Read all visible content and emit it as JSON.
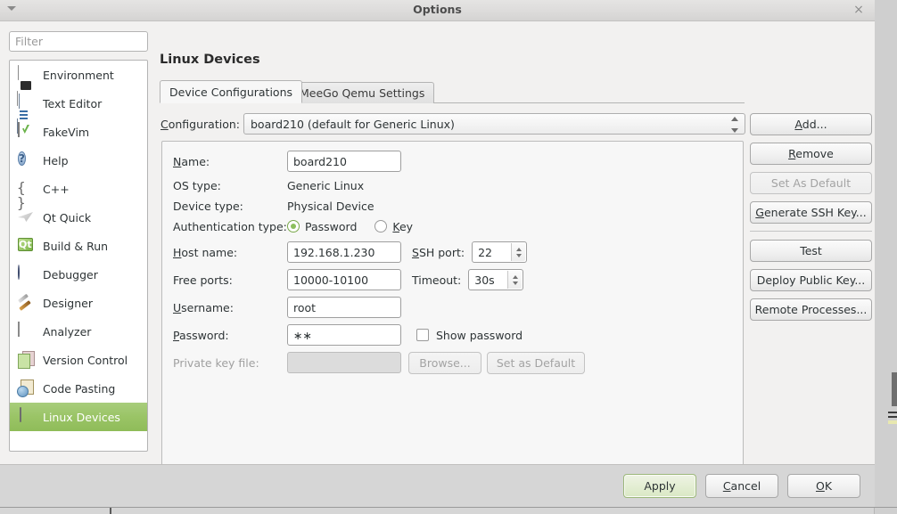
{
  "window": {
    "title": "Options",
    "close_label": "×",
    "menu_caret": "menu-caret"
  },
  "sidebar": {
    "filter_placeholder": "Filter",
    "filter_value": "",
    "items": [
      {
        "label": "Environment",
        "icon": "environment-icon",
        "selected": false
      },
      {
        "label": "Text Editor",
        "icon": "text-editor-icon",
        "selected": false
      },
      {
        "label": "FakeVim",
        "icon": "fakevim-icon",
        "selected": false
      },
      {
        "label": "Help",
        "icon": "help-icon",
        "selected": false
      },
      {
        "label": "C++",
        "icon": "cpp-icon",
        "selected": false
      },
      {
        "label": "Qt Quick",
        "icon": "qt-quick-icon",
        "selected": false
      },
      {
        "label": "Build & Run",
        "icon": "build-run-icon",
        "selected": false
      },
      {
        "label": "Debugger",
        "icon": "debugger-icon",
        "selected": false
      },
      {
        "label": "Designer",
        "icon": "designer-icon",
        "selected": false
      },
      {
        "label": "Analyzer",
        "icon": "analyzer-icon",
        "selected": false
      },
      {
        "label": "Version Control",
        "icon": "version-control-icon",
        "selected": false
      },
      {
        "label": "Code Pasting",
        "icon": "code-pasting-icon",
        "selected": false
      },
      {
        "label": "Linux Devices",
        "icon": "linux-devices-icon",
        "selected": true
      }
    ]
  },
  "page": {
    "title": "Linux Devices",
    "tabs": [
      {
        "label": "Device Configurations",
        "active": true
      },
      {
        "label": "MeeGo Qemu Settings",
        "active": false
      }
    ]
  },
  "configuration": {
    "label": "Configuration:",
    "label_mnemonic": "C",
    "selected_value": "board210 (default for Generic Linux)"
  },
  "form": {
    "name": {
      "label": "Name:",
      "label_mnemonic": "N",
      "value": "board210"
    },
    "os_type": {
      "label": "OS type:",
      "value": "Generic Linux"
    },
    "device_type": {
      "label": "Device type:",
      "value": "Physical Device"
    },
    "authentication_type": {
      "label": "Authentication type:",
      "options": [
        {
          "label": "Password",
          "mnemonic": "",
          "checked": true
        },
        {
          "label": "Key",
          "mnemonic": "K",
          "checked": false
        }
      ]
    },
    "host_name": {
      "label": "Host name:",
      "label_mnemonic": "H",
      "value": "192.168.1.230"
    },
    "ssh_port": {
      "label": "SSH port:",
      "label_mnemonic": "S",
      "value": "22"
    },
    "free_ports": {
      "label": "Free ports:",
      "value": "10000-10100"
    },
    "timeout": {
      "label": "Timeout:",
      "value": "30s"
    },
    "username": {
      "label": "Username:",
      "label_mnemonic": "U",
      "value": "root"
    },
    "password": {
      "label": "Password:",
      "label_mnemonic": "P",
      "value": "∗∗"
    },
    "show_password": {
      "label": "Show password",
      "checked": false
    },
    "private_key_file": {
      "label": "Private key file:",
      "value": "",
      "disabled": true,
      "browse_label": "Browse...",
      "set_default_label": "Set as Default"
    }
  },
  "side_buttons": [
    {
      "label": "Add...",
      "mnemonic": "A",
      "disabled": false
    },
    {
      "label": "Remove",
      "mnemonic": "R",
      "disabled": false
    },
    {
      "label": "Set As Default",
      "mnemonic": "",
      "disabled": true
    },
    {
      "label": "Generate SSH Key...",
      "mnemonic": "G",
      "disabled": false
    },
    {
      "label": "Test",
      "mnemonic": "",
      "disabled": false
    },
    {
      "label": "Deploy Public Key...",
      "mnemonic": "",
      "disabled": false
    },
    {
      "label": "Remote Processes...",
      "mnemonic": "",
      "disabled": false
    }
  ],
  "dialog_buttons": [
    {
      "label": "Apply",
      "mnemonic": "",
      "default": true
    },
    {
      "label": "Cancel",
      "mnemonic": "C",
      "default": false
    },
    {
      "label": "OK",
      "mnemonic": "O",
      "default": false
    }
  ],
  "colors": {
    "selection_green": "#9ac466",
    "radio_green": "#8cbf5d",
    "dialog_bg": "#f2f1f0",
    "bottom_bar_bg": "#d6d6d6"
  }
}
